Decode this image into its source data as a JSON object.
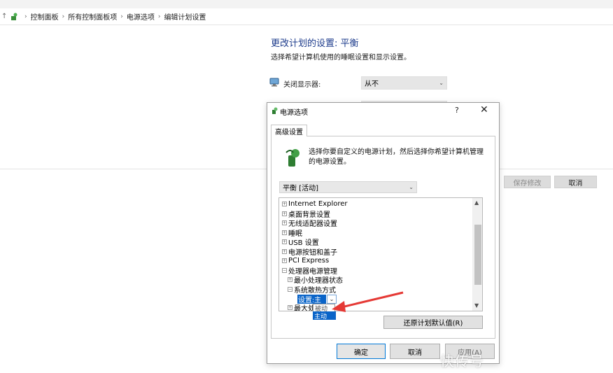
{
  "breadcrumb": {
    "items": [
      "控制面板",
      "所有控制面板项",
      "电源选项",
      "编辑计划设置"
    ]
  },
  "page": {
    "title": "更改计划的设置: 平衡",
    "subtitle": "选择希望计算机使用的睡眠设置和显示设置。",
    "display_label": "关闭显示器:",
    "display_value": "从不",
    "save_button": "保存修改",
    "cancel_button": "取消"
  },
  "dialog": {
    "title": "电源选项",
    "help": "?",
    "close": "✕",
    "tab": "高级设置",
    "intro": "选择你要自定义的电源计划，然后选择你希望计算机管理的电源设置。",
    "plan": "平衡 [活动]",
    "tree": [
      {
        "label": "Internet Explorer",
        "expander": "+"
      },
      {
        "label": "桌面背景设置",
        "expander": "+"
      },
      {
        "label": "无线适配器设置",
        "expander": "+"
      },
      {
        "label": "睡眠",
        "expander": "+"
      },
      {
        "label": "USB 设置",
        "expander": "+"
      },
      {
        "label": "电源按钮和盖子",
        "expander": "+"
      },
      {
        "label": "PCI Express",
        "expander": "+"
      },
      {
        "label": "处理器电源管理",
        "expander": "−"
      },
      {
        "label": "最小处理器状态",
        "expander": "+"
      },
      {
        "label": "系统散热方式",
        "expander": "−"
      },
      {
        "label": "最大处",
        "expander": "+"
      }
    ],
    "setting_label": "设置:",
    "setting_value": "主",
    "dropdown_options": [
      "被动",
      "主动"
    ],
    "restore_button": "还原计划默认值(R)",
    "ok_button": "确定",
    "cancel_button": "取消",
    "apply_button": "应用(A)"
  },
  "watermark": "快传号",
  "colors": {
    "accent": "#0a64c8",
    "title_blue": "#1e3c8c",
    "arrow_red": "#e53935"
  }
}
